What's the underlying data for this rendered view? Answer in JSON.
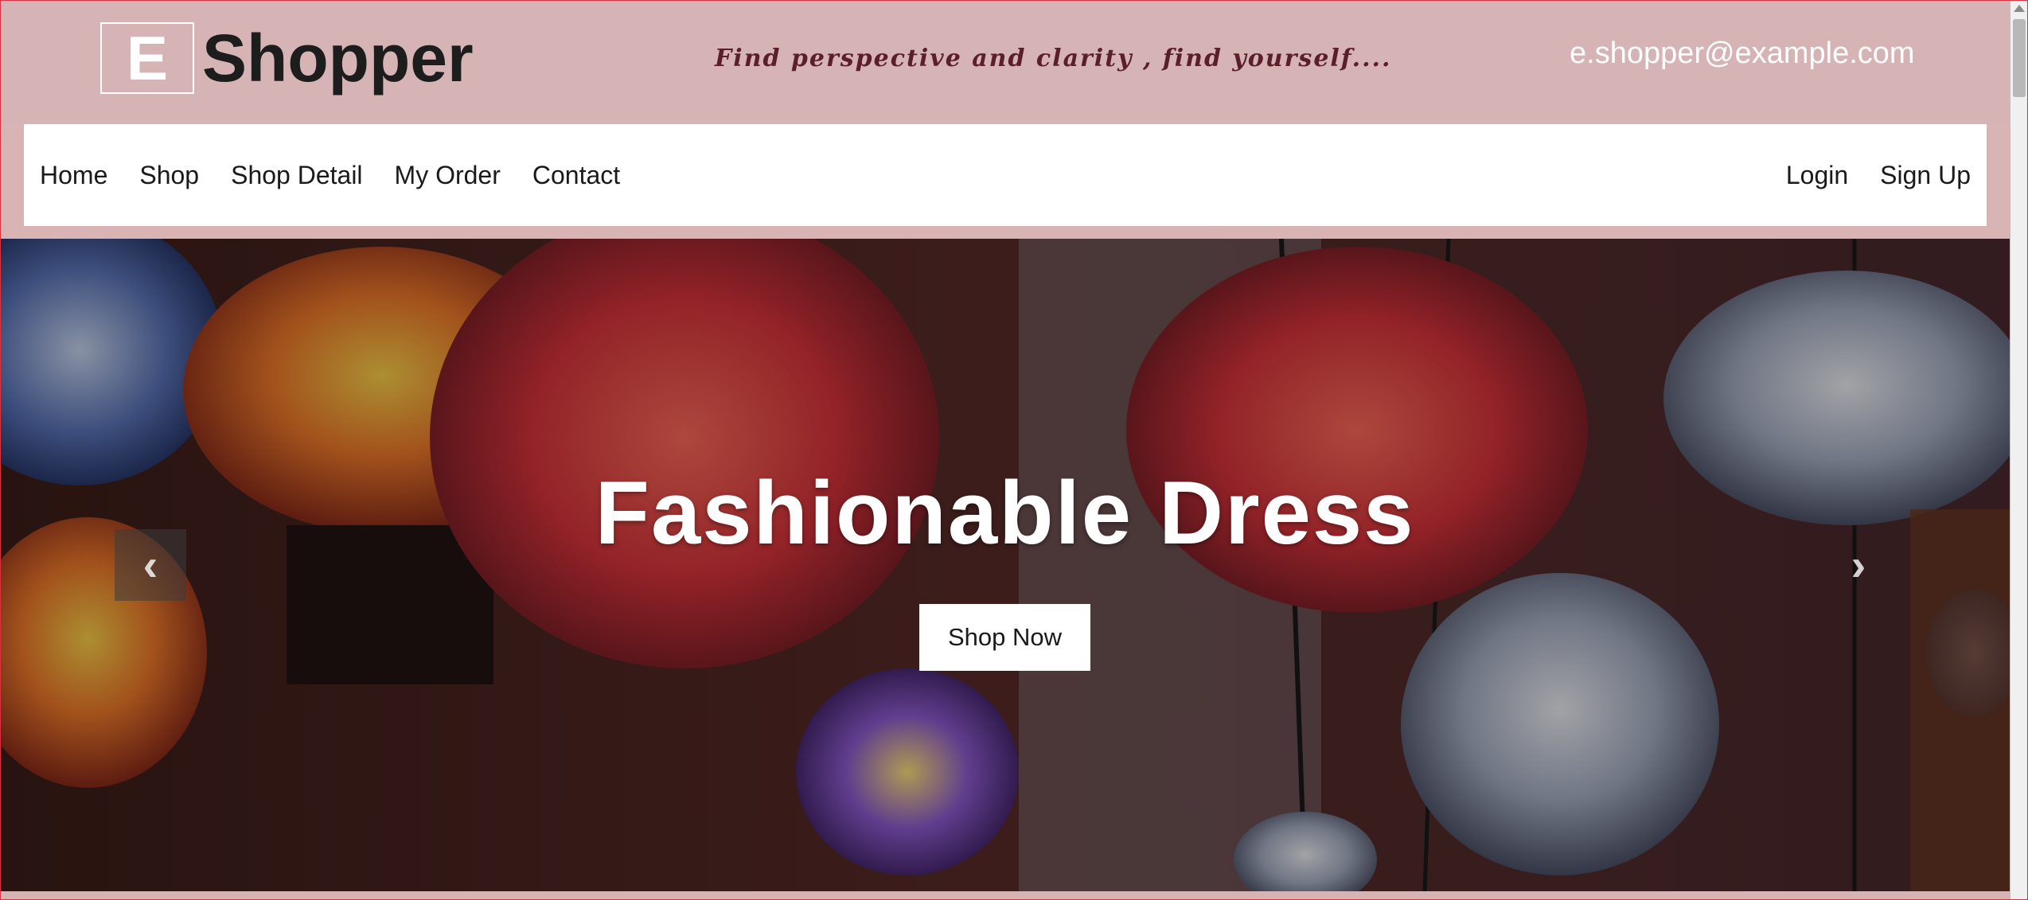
{
  "header": {
    "logo_letter": "E",
    "logo_text": "Shopper",
    "tagline": "Find perspective and clarity , find yourself....",
    "email": "e.shopper@example.com"
  },
  "nav": {
    "left": [
      "Home",
      "Shop",
      "Shop Detail",
      "My Order",
      "Contact"
    ],
    "right": [
      "Login",
      "Sign Up"
    ]
  },
  "hero": {
    "title": "Fashionable Dress",
    "button": "Shop Now",
    "prev_icon": "chevron-left-icon",
    "next_icon": "chevron-right-icon"
  },
  "colors": {
    "header_bg": "#d6b3b4",
    "tagline": "#5b1f28",
    "nav_bg": "#ffffff",
    "accent_border": "#d9323f"
  }
}
